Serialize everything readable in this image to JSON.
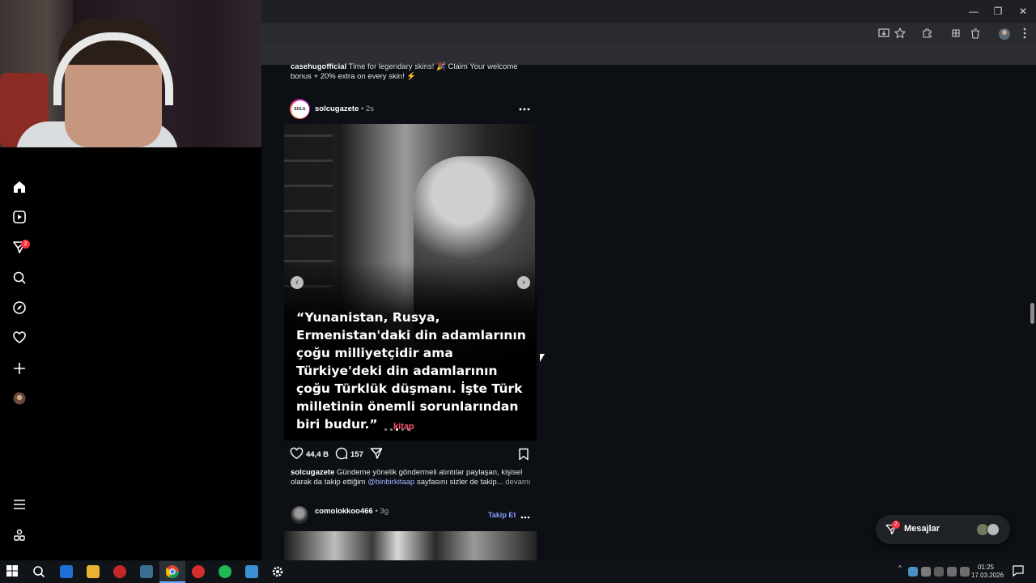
{
  "window": {
    "minimize": "—",
    "restore": "❐",
    "close": "✕"
  },
  "sidebar": {
    "notification_badge": "2",
    "items": [
      {
        "name": "home"
      },
      {
        "name": "reels"
      },
      {
        "name": "messages"
      },
      {
        "name": "search"
      },
      {
        "name": "explore"
      },
      {
        "name": "notifications"
      },
      {
        "name": "create"
      },
      {
        "name": "profile"
      },
      {
        "name": "more"
      },
      {
        "name": "also-from-meta"
      }
    ]
  },
  "prev_post": {
    "user": "casehugofficial",
    "text": "Time for legendary skins! 🎉 Claim Your welcome bonus + 20% extra on every skin! ⚡"
  },
  "post": {
    "avatar_text": "SOLG",
    "user": "solcugazete",
    "time": "• 2s",
    "quote": "“Yunanistan, Rusya, Ermenistan'daki din adamlarının çoğu milliyetçidir ama Türkiye'deki din adamlarının çoğu Türklük düşmanı. İşte Türk milletinin önemli sorunlarından biri budur.”",
    "watermark": "kitap",
    "likes": "44,4 B",
    "comments": "157",
    "caption_user": "solcugazete",
    "caption_text": "Gündeme yönelik göndermeli alıntılar paylaşan, kişisel olarak da takip ettiğim",
    "caption_mention": "@binbirkitaap",
    "caption_rest": "sayfasını sizler de takip...",
    "more_label": "devamı"
  },
  "next_post": {
    "user": "comolokkoo466",
    "time": "• 3g",
    "follow_label": "Takip Et"
  },
  "messages": {
    "label": "Mesajlar",
    "badge": "2"
  },
  "taskbar": {
    "time": "01:25",
    "date": "17.03.2026"
  },
  "colors": {
    "accent": "#0095f6",
    "follow": "#8c9cff",
    "badge": "#ff3040",
    "background": "#0c0f14"
  }
}
